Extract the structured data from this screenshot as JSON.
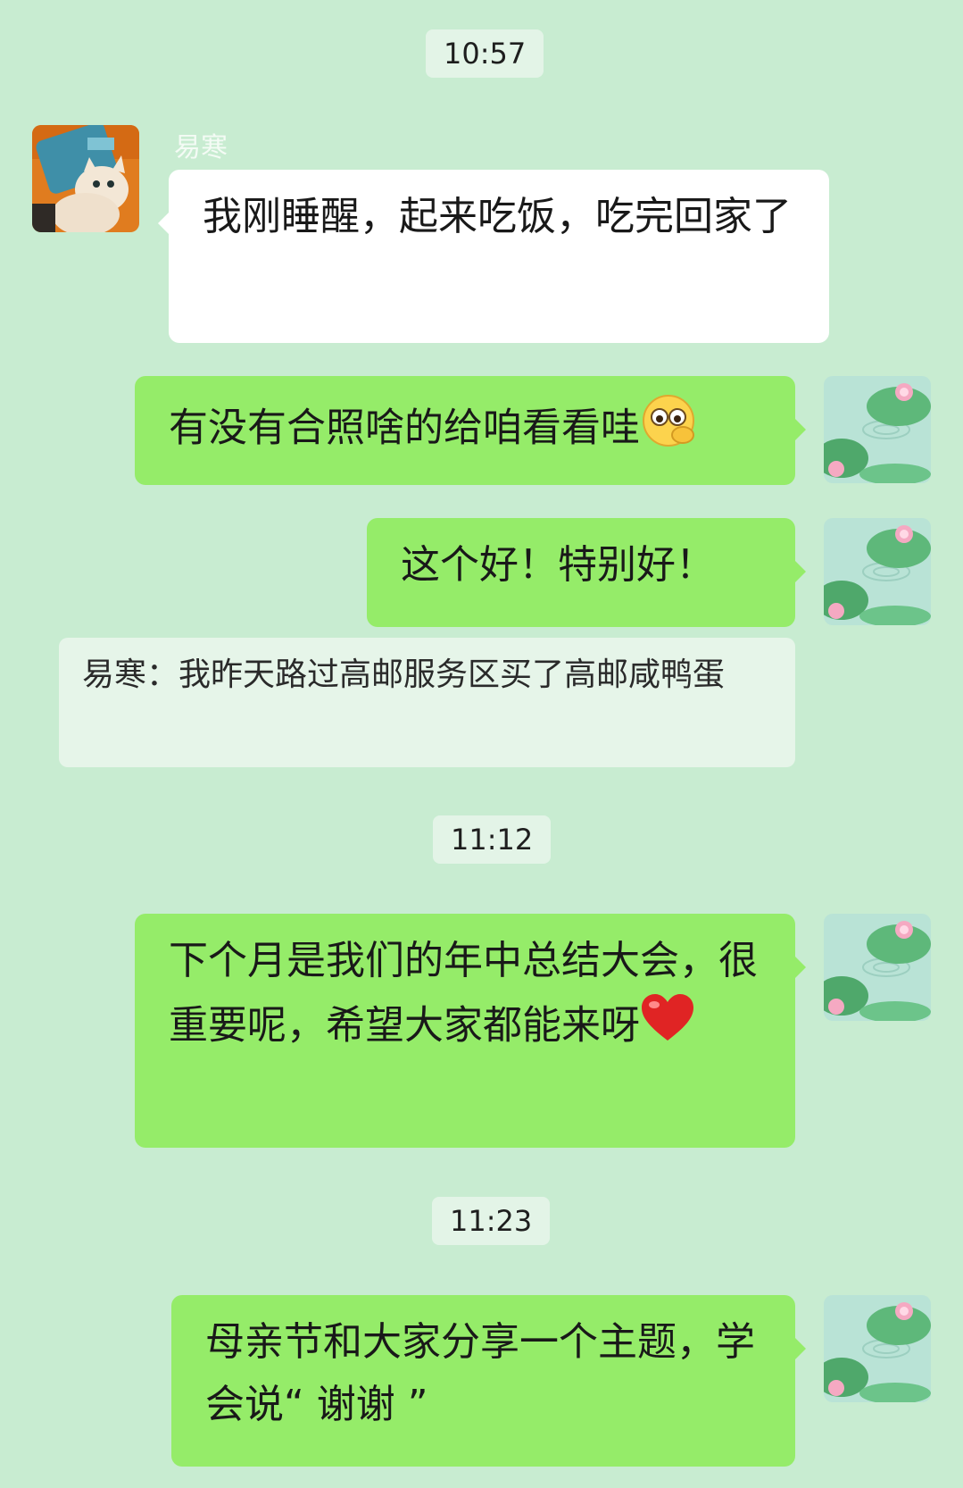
{
  "chat": {
    "timestamps": [
      "10:57",
      "11:12",
      "11:23"
    ],
    "sender_name": "易寒",
    "messages": [
      {
        "dir": "in",
        "text": "我刚睡醒，起来吃饭，吃完回家了"
      },
      {
        "dir": "out",
        "text": "有没有合照啥的给咱看看哇",
        "emoji": "peeking-face"
      },
      {
        "dir": "out",
        "text": "这个好！特别好！"
      },
      {
        "dir": "out",
        "text": "下个月是我们的年中总结大会，很重要呢，希望大家都能来呀",
        "emoji": "red-heart"
      },
      {
        "dir": "out",
        "text": "母亲节和大家分享一个主题，学会说“ 谢谢 ”"
      }
    ],
    "quote": {
      "text": "易寒：我昨天路过高邮服务区买了高邮咸鸭蛋"
    }
  },
  "icons": {
    "peeking_emoji": "peeking-face",
    "heart_emoji": "red-heart",
    "other_avatar": "cat-avatar",
    "self_avatar": "lotus-pond-avatar"
  },
  "colors": {
    "background": "#c8ecd1",
    "outgoing_bubble": "#95ec69",
    "incoming_bubble": "#ffffff",
    "timestamp_bg": "#e3f4e7"
  }
}
